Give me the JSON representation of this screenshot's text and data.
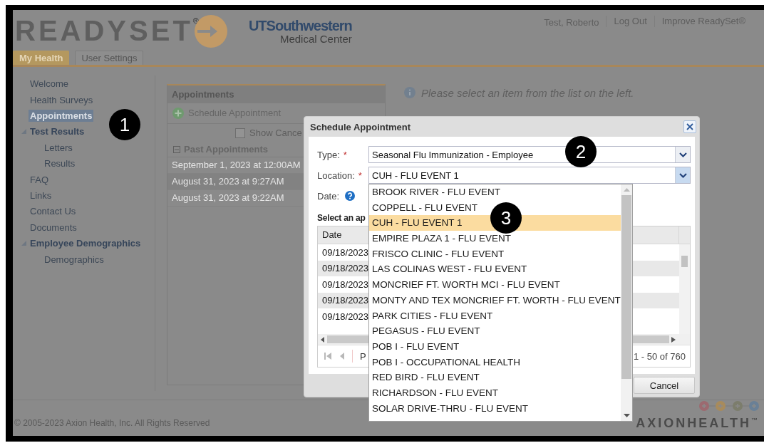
{
  "header": {
    "logo": "READYSET$^{®}$",
    "org_name": "UTSouthwestern",
    "org_subtitle": "Medical Center",
    "user_links": [
      "Test, Roberto",
      "Log Out",
      "Improve ReadySet®"
    ]
  },
  "tabs": [
    {
      "label": "My Health",
      "selected": true
    },
    {
      "label": "User Settings",
      "selected": false
    }
  ],
  "sidebar": {
    "items": [
      {
        "label": "Welcome",
        "selected": false
      },
      {
        "label": "Health Surveys",
        "selected": false
      },
      {
        "label": "Appointments",
        "selected": true
      },
      {
        "label": "Test Results",
        "selected": false,
        "expanded": true,
        "children": [
          {
            "label": "Letters",
            "selected": false
          },
          {
            "label": "Results",
            "selected": false
          }
        ]
      },
      {
        "label": "FAQ",
        "selected": false
      },
      {
        "label": "Links",
        "selected": false
      },
      {
        "label": "Contact Us",
        "selected": false
      },
      {
        "label": "Documents",
        "selected": false
      },
      {
        "label": "Employee Demographics",
        "selected": false,
        "expanded": true,
        "children": [
          {
            "label": "Demographics",
            "selected": false
          }
        ]
      }
    ]
  },
  "appointments_panel": {
    "title": "Appointments",
    "schedule_action": "Schedule Appointment",
    "show_cancelled": {
      "label": "Show Cance",
      "checked": false
    },
    "past_section": {
      "title": "Past Appointments",
      "expanded": true,
      "rows": [
        {
          "text": "September 1, 2023 at 12:00AM",
          "selected": false
        },
        {
          "text": "August 31, 2023 at 9:27AM",
          "selected": true
        },
        {
          "text": "August 31, 2023 at 9:22AM",
          "selected": false
        }
      ]
    }
  },
  "info_message": "Please select an item from the list on the left.",
  "footer": {
    "copyright": "© 2005-2023 Axion Health, Inc. All Rights Reserved",
    "logo": "AXIONHEALTH$^{™}$"
  },
  "dialog": {
    "title": "Schedule Appointment",
    "fields": [
      {
        "label": "Type:",
        "required_mark": "*",
        "value": "Seasonal Flu Immunization - Employee",
        "focused": false
      },
      {
        "label": "Location:",
        "required_mark": "*",
        "value": "CUH - FLU EVENT 1",
        "focused": true
      }
    ],
    "date_label": "Date:",
    "grid_caption": "Select an ap",
    "grid": {
      "columns": [
        "Date"
      ],
      "rows": [
        "09/18/2023",
        "09/18/2023",
        "09/18/2023",
        "09/18/2023",
        "09/18/2023"
      ]
    },
    "paging_label": "P",
    "paging_summary": "1 - 50 of 760",
    "cancel_button": "Cancel"
  },
  "location_dropdown": {
    "options": [
      {
        "label": "BROOK RIVER - FLU EVENT",
        "selected": false
      },
      {
        "label": "COPPELL - FLU EVENT",
        "selected": false
      },
      {
        "label": "CUH - FLU EVENT 1",
        "selected": true
      },
      {
        "label": "EMPIRE PLAZA 1 - FLU EVENT",
        "selected": false
      },
      {
        "label": "FRISCO CLINIC - FLU EVENT",
        "selected": false
      },
      {
        "label": "LAS COLINAS WEST - FLU EVENT",
        "selected": false
      },
      {
        "label": "MONCRIEF FT. WORTH MCI - FLU EVENT",
        "selected": false
      },
      {
        "label": "MONTY AND TEX MONCRIEF FT. WORTH - FLU EVENT",
        "selected": false
      },
      {
        "label": "PARK CITIES - FLU EVENT",
        "selected": false
      },
      {
        "label": "PEGASUS - FLU EVENT",
        "selected": false
      },
      {
        "label": "POB I - FLU EVENT",
        "selected": false
      },
      {
        "label": "POB I - OCCUPATIONAL HEALTH",
        "selected": false
      },
      {
        "label": "RED BIRD - FLU EVENT",
        "selected": false
      },
      {
        "label": "RICHARDSON - FLU EVENT",
        "selected": false
      },
      {
        "label": "SOLAR DRIVE-THRU - FLU EVENT",
        "selected": false
      }
    ]
  },
  "annotations": [
    "1",
    "2",
    "3"
  ]
}
